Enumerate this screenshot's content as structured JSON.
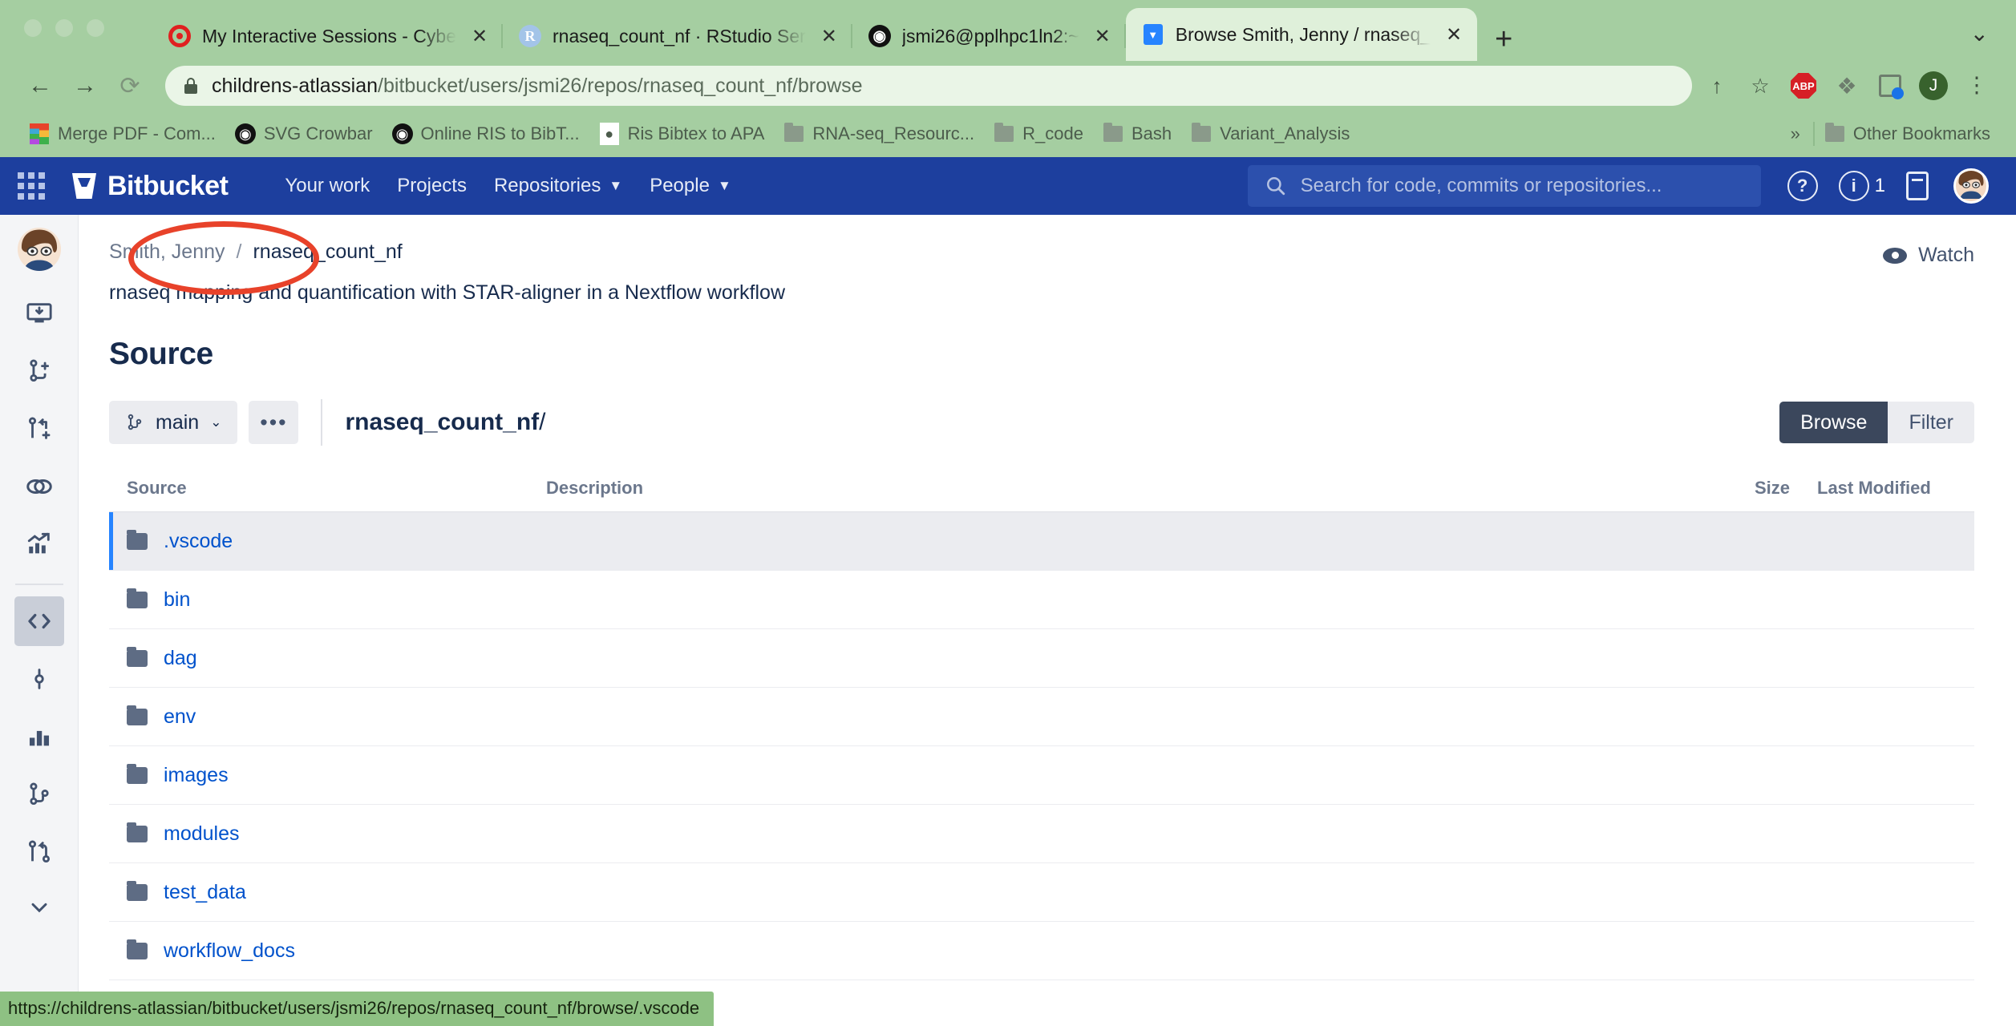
{
  "browser": {
    "tabs": [
      {
        "title": "My Interactive Sessions - Cybe",
        "favicon": "cyberduck-icon",
        "active": false,
        "close": "✕"
      },
      {
        "title": "rnaseq_count_nf · RStudio Ser",
        "favicon": "rstudio-icon",
        "active": false,
        "close": "✕"
      },
      {
        "title": "jsmi26@pplhpc1ln2:~",
        "favicon": "terminal-globe-icon",
        "active": false,
        "close": "✕"
      },
      {
        "title": "Browse Smith, Jenny / rnaseq_",
        "favicon": "bitbucket-icon",
        "active": true,
        "close": "✕"
      }
    ],
    "new_tab_label": "+",
    "tab_list_chevron": "⌄",
    "nav": {
      "back": "←",
      "forward": "→",
      "reload": "⟳"
    },
    "url": {
      "host": "childrens-atlassian",
      "path": "/bitbucket/users/jsmi26/repos/rnaseq_count_nf/browse",
      "full": "childrens-atlassian/bitbucket/users/jsmi26/repos/rnaseq_count_nf/browse"
    },
    "omni_actions": {
      "share": "↑",
      "bookmark": "☆",
      "adblock": "ABP",
      "extensions": "🧩",
      "side_panel": "panel-icon",
      "profile_initial": "J",
      "menu": "⋮"
    },
    "bookmarks": [
      {
        "label": "Merge PDF - Com...",
        "icon": "merge-pdf-icon"
      },
      {
        "label": "SVG Crowbar",
        "icon": "globe-icon"
      },
      {
        "label": "Online RIS to BibT...",
        "icon": "globe-icon"
      },
      {
        "label": "Ris Bibtex to APA",
        "icon": "page-icon"
      },
      {
        "label": "RNA-seq_Resourc...",
        "icon": "folder-icon"
      },
      {
        "label": "R_code",
        "icon": "folder-icon"
      },
      {
        "label": "Bash",
        "icon": "folder-icon"
      },
      {
        "label": "Variant_Analysis",
        "icon": "folder-icon"
      }
    ],
    "bookmarks_overflow": "»",
    "other_bookmarks": {
      "label": "Other Bookmarks",
      "icon": "folder-icon"
    },
    "status_url": "https://childrens-atlassian/bitbucket/users/jsmi26/repos/rnaseq_count_nf/browse/.vscode"
  },
  "bitbucket": {
    "brand": "Bitbucket",
    "nav_links": [
      {
        "label": "Your work",
        "has_caret": false
      },
      {
        "label": "Projects",
        "has_caret": false
      },
      {
        "label": "Repositories",
        "has_caret": true
      },
      {
        "label": "People",
        "has_caret": true
      }
    ],
    "search_placeholder": "Search for code, commits or repositories...",
    "help_icon": "?",
    "notifications_icon": "i",
    "notifications_count": "1",
    "tablet_icon": "tablet-icon",
    "sidebar": [
      {
        "name": "clone-icon"
      },
      {
        "name": "create-branch-icon"
      },
      {
        "name": "create-pull-request-icon"
      },
      {
        "name": "compare-icon"
      },
      {
        "name": "insights-icon"
      },
      {
        "name": "source-icon",
        "active": true
      },
      {
        "name": "commits-icon"
      },
      {
        "name": "charts-icon"
      },
      {
        "name": "branches-icon"
      },
      {
        "name": "pull-requests-icon"
      },
      {
        "name": "more-icon"
      }
    ]
  },
  "page": {
    "breadcrumb": {
      "owner": "Smith, Jenny",
      "separator": "/",
      "repo": "rnaseq_count_nf"
    },
    "watch_label": "Watch",
    "repo_description": "rnaseq mapping and quantification with STAR-aligner in a Nextflow workflow",
    "section_title": "Source",
    "branch": "main",
    "branch_caret": "⌄",
    "more_actions": "•••",
    "repo_path": "rnaseq_count_nf",
    "repo_path_slash": "/",
    "view_modes": [
      {
        "label": "Browse",
        "active": true
      },
      {
        "label": "Filter",
        "active": false
      }
    ],
    "table": {
      "headers": {
        "source": "Source",
        "description": "Description",
        "size": "Size",
        "modified": "Last Modified"
      },
      "rows": [
        {
          "name": ".vscode",
          "type": "folder",
          "description": "",
          "size": "",
          "modified": "",
          "selected": true
        },
        {
          "name": "bin",
          "type": "folder",
          "description": "",
          "size": "",
          "modified": "",
          "selected": false
        },
        {
          "name": "dag",
          "type": "folder",
          "description": "",
          "size": "",
          "modified": "",
          "selected": false
        },
        {
          "name": "env",
          "type": "folder",
          "description": "",
          "size": "",
          "modified": "",
          "selected": false
        },
        {
          "name": "images",
          "type": "folder",
          "description": "",
          "size": "",
          "modified": "",
          "selected": false
        },
        {
          "name": "modules",
          "type": "folder",
          "description": "",
          "size": "",
          "modified": "",
          "selected": false
        },
        {
          "name": "test_data",
          "type": "folder",
          "description": "",
          "size": "",
          "modified": "",
          "selected": false
        },
        {
          "name": "workflow_docs",
          "type": "folder",
          "description": "",
          "size": "",
          "modified": "",
          "selected": false
        }
      ]
    }
  },
  "annotation": {
    "shape": "ellipse",
    "color": "#e8422a",
    "target": "Smith, Jenny"
  },
  "colors": {
    "browser_chrome": "#a5cea1",
    "bitbucket_blue": "#1d3f9e",
    "link_blue": "#0052cc",
    "text_dark": "#172b4d",
    "annotation_red": "#e8422a",
    "selected_row": "#ebecf0"
  }
}
